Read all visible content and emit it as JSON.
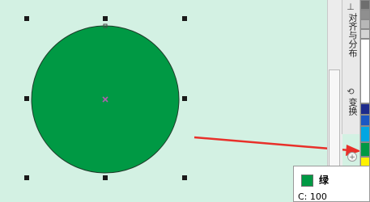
{
  "colors": {
    "canvas_bg": "#d3f1e3",
    "circle_fill": "#009944",
    "circle_stroke": "#1f3b2a",
    "handle": "#1a1a1a",
    "arrow": "#e8302a",
    "center_mark": "#b25fb0"
  },
  "docker": {
    "tabs": [
      {
        "label": "对齐与分布",
        "icon": "align-icon"
      },
      {
        "label": "变换",
        "icon": "transform-icon"
      }
    ]
  },
  "palette": {
    "swatches": [
      {
        "name": "gray-dark",
        "color": "#6e6e6e"
      },
      {
        "name": "gray",
        "color": "#8f8f8f"
      },
      {
        "name": "gray-light",
        "color": "#b7b7b7"
      },
      {
        "name": "gray-lighter",
        "color": "#d4d4d4"
      },
      {
        "name": "white",
        "color": "#ffffff"
      },
      {
        "name": "navy",
        "color": "#1d2b8c"
      },
      {
        "name": "blue",
        "color": "#1b58c4"
      },
      {
        "name": "cyan",
        "color": "#00a6e2"
      },
      {
        "name": "green",
        "color": "#009944"
      },
      {
        "name": "yellow",
        "color": "#fff200"
      }
    ]
  },
  "tooltip": {
    "color_name": "绿",
    "cmyk_text": "C: 100",
    "swatch_color": "#009944"
  }
}
